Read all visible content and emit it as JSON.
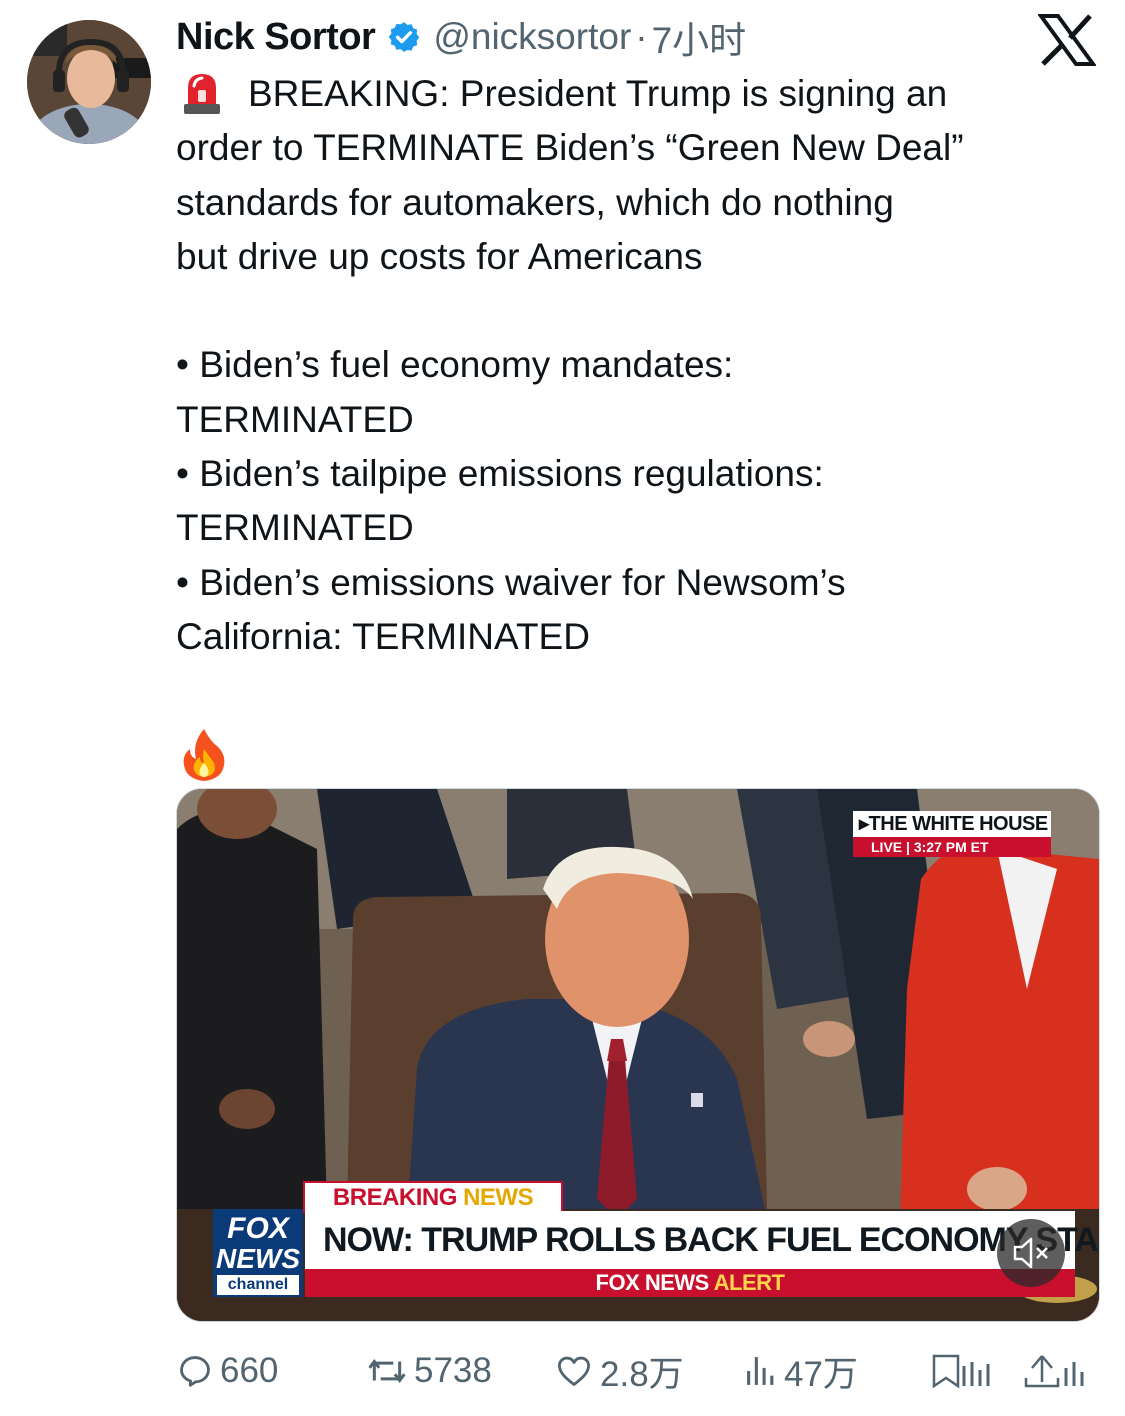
{
  "post": {
    "author_name": "Nick Sortor",
    "handle": "@nicksortor",
    "separator": "·",
    "time": "7小时",
    "text_lines": [
      "BREAKING: President Trump is signing an",
      "order to TERMINATE Biden’s “Green New Deal”",
      "standards for automakers, which do nothing",
      "but drive up costs for Americans",
      "• Biden’s fuel economy mandates:",
      "TERMINATED",
      "• Biden’s tailpipe emissions regulations:",
      "TERMINATED",
      "• Biden’s emissions waiver for Newsom’s",
      "California: TERMINATED"
    ]
  },
  "video": {
    "location_badge": "▸THE WHITE HOUSE",
    "live_label": "LIVE",
    "live_time": "3:27 PM ET",
    "breaking_part1": "BREAKING",
    "breaking_part2": "NEWS",
    "logo_line1": "FOX",
    "logo_line2": "NEWS",
    "logo_line3": "channel",
    "headline": "NOW: TRUMP ROLLS BACK FUEL ECONOMY STANDARDS",
    "alert_part1": "FOX NEWS",
    "alert_part2": "ALERT"
  },
  "actions": {
    "replies": "660",
    "reposts": "5738",
    "likes": "2.8万",
    "views": "47万"
  },
  "icons": {
    "verified": "verified-badge-icon",
    "platform": "x-logo-icon",
    "siren": "siren-emoji-icon",
    "fire": "fire-emoji-icon",
    "mute": "mute-icon",
    "reply": "reply-icon",
    "repost": "repost-icon",
    "like": "heart-icon",
    "views": "views-icon",
    "bookmark": "bookmark-icon",
    "share": "share-icon"
  },
  "colors": {
    "text_primary": "#0f1419",
    "text_secondary": "#536471",
    "verified_blue": "#1d9bf0",
    "fox_red": "#c8102e",
    "fox_blue": "#0b3a78"
  }
}
